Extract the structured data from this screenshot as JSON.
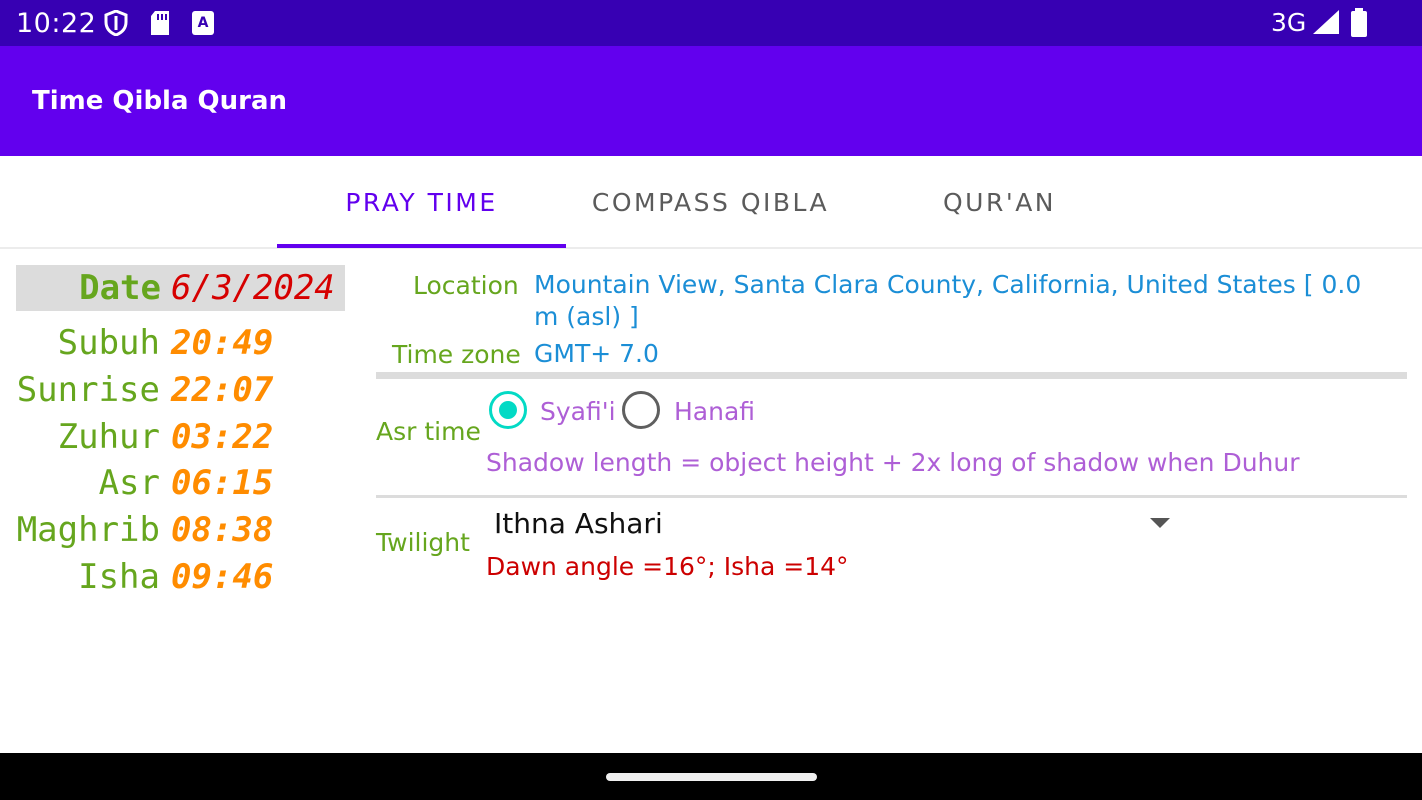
{
  "status_bar": {
    "time": "10:22",
    "network": "3G",
    "icons": [
      "shield-icon",
      "sd-card-icon",
      "accessibility-a-icon",
      "signal-icon",
      "battery-icon"
    ]
  },
  "app_bar": {
    "title": "Time Qibla Quran"
  },
  "tabs": [
    {
      "label": "PRAY TIME",
      "active": true
    },
    {
      "label": "COMPASS QIBLA",
      "active": false
    },
    {
      "label": "QUR'AN",
      "active": false
    }
  ],
  "schedule": {
    "date_label": "Date",
    "date_value": "6/3/2024",
    "prayers": [
      {
        "name": "Subuh",
        "time": "20:49"
      },
      {
        "name": "Sunrise",
        "time": "22:07"
      },
      {
        "name": "Zuhur",
        "time": "03:22"
      },
      {
        "name": "Asr",
        "time": "06:15"
      },
      {
        "name": "Maghrib",
        "time": "08:38"
      },
      {
        "name": "Isha",
        "time": "09:46"
      }
    ]
  },
  "info": {
    "location_label": "Location",
    "location_value": "Mountain View, Santa Clara County, California, United States [ 0.0 m (asl) ]",
    "timezone_label": "Time zone",
    "timezone_value": "GMT+ 7.0",
    "asr_label": "Asr time",
    "asr_options": [
      {
        "label": "Syafi'i",
        "selected": true
      },
      {
        "label": "Hanafi",
        "selected": false
      }
    ],
    "asr_description": "Shadow length = object height + 2x long of shadow when Duhur",
    "twilight_label": "Twilight",
    "twilight_value": "Ithna Ashari",
    "twilight_description": "Dawn angle =16°; Isha =14°"
  },
  "colors": {
    "status_bar": "#3700b3",
    "app_bar": "#6200ee",
    "accent": "#03dac5",
    "label_green": "#66a61e",
    "time_orange": "#ff8c00",
    "date_red": "#d60000",
    "value_blue": "#1b8ed6",
    "asr_purple": "#ae5fd6"
  }
}
